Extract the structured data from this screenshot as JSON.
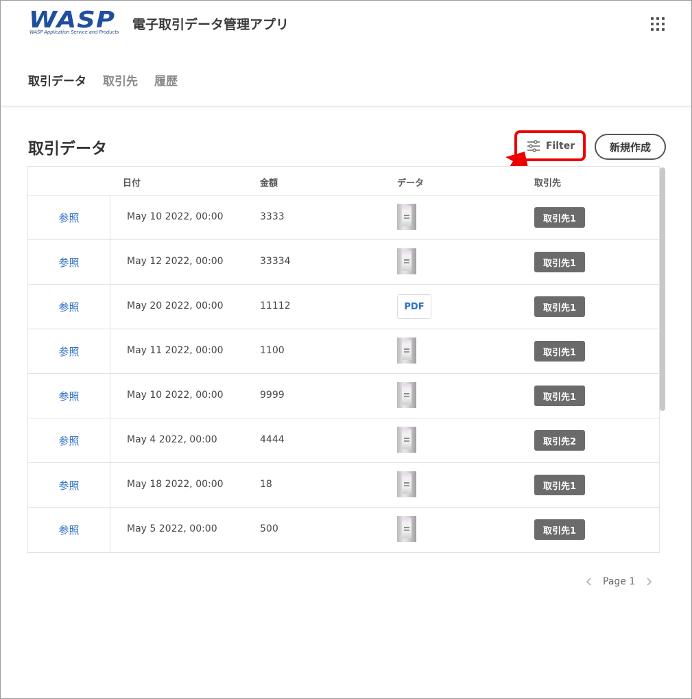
{
  "header": {
    "logo_text": "WASP",
    "logo_subtext": "WASP Application Service and Products",
    "app_title": "電子取引データ管理アプリ",
    "menu_icon": "apps-grid-icon"
  },
  "nav": {
    "items": [
      {
        "label": "取引データ",
        "active": true
      },
      {
        "label": "取引先",
        "active": false
      },
      {
        "label": "履歴",
        "active": false
      }
    ]
  },
  "main": {
    "title": "取引データ",
    "filter_label": "Filter",
    "filter_icon": "sliders-icon",
    "new_label": "新規作成",
    "highlight_color": "#ee0000"
  },
  "table": {
    "columns": [
      "日付",
      "金額",
      "データ",
      "取引先"
    ],
    "rows": [
      {
        "view": "参照",
        "date": "May 10 2022, 00:00",
        "amount": "3333",
        "data": "image",
        "partner": "取引先1"
      },
      {
        "view": "参照",
        "date": "May 12 2022, 00:00",
        "amount": "33334",
        "data": "image",
        "partner": "取引先1"
      },
      {
        "view": "参照",
        "date": "May 20 2022, 00:00",
        "amount": "11112",
        "data": "PDF",
        "partner": "取引先1"
      },
      {
        "view": "参照",
        "date": "May 11 2022, 00:00",
        "amount": "1100",
        "data": "image",
        "partner": "取引先1"
      },
      {
        "view": "参照",
        "date": "May 10 2022, 00:00",
        "amount": "9999",
        "data": "image",
        "partner": "取引先1"
      },
      {
        "view": "参照",
        "date": "May 4 2022, 00:00",
        "amount": "4444",
        "data": "image",
        "partner": "取引先2"
      },
      {
        "view": "参照",
        "date": "May 18 2022, 00:00",
        "amount": "18",
        "data": "image",
        "partner": "取引先1"
      },
      {
        "view": "参照",
        "date": "May 5 2022, 00:00",
        "amount": "500",
        "data": "image",
        "partner": "取引先1"
      }
    ]
  },
  "pagination": {
    "label": "Page 1",
    "prev_icon": "chevron-left-icon",
    "next_icon": "chevron-right-icon"
  }
}
